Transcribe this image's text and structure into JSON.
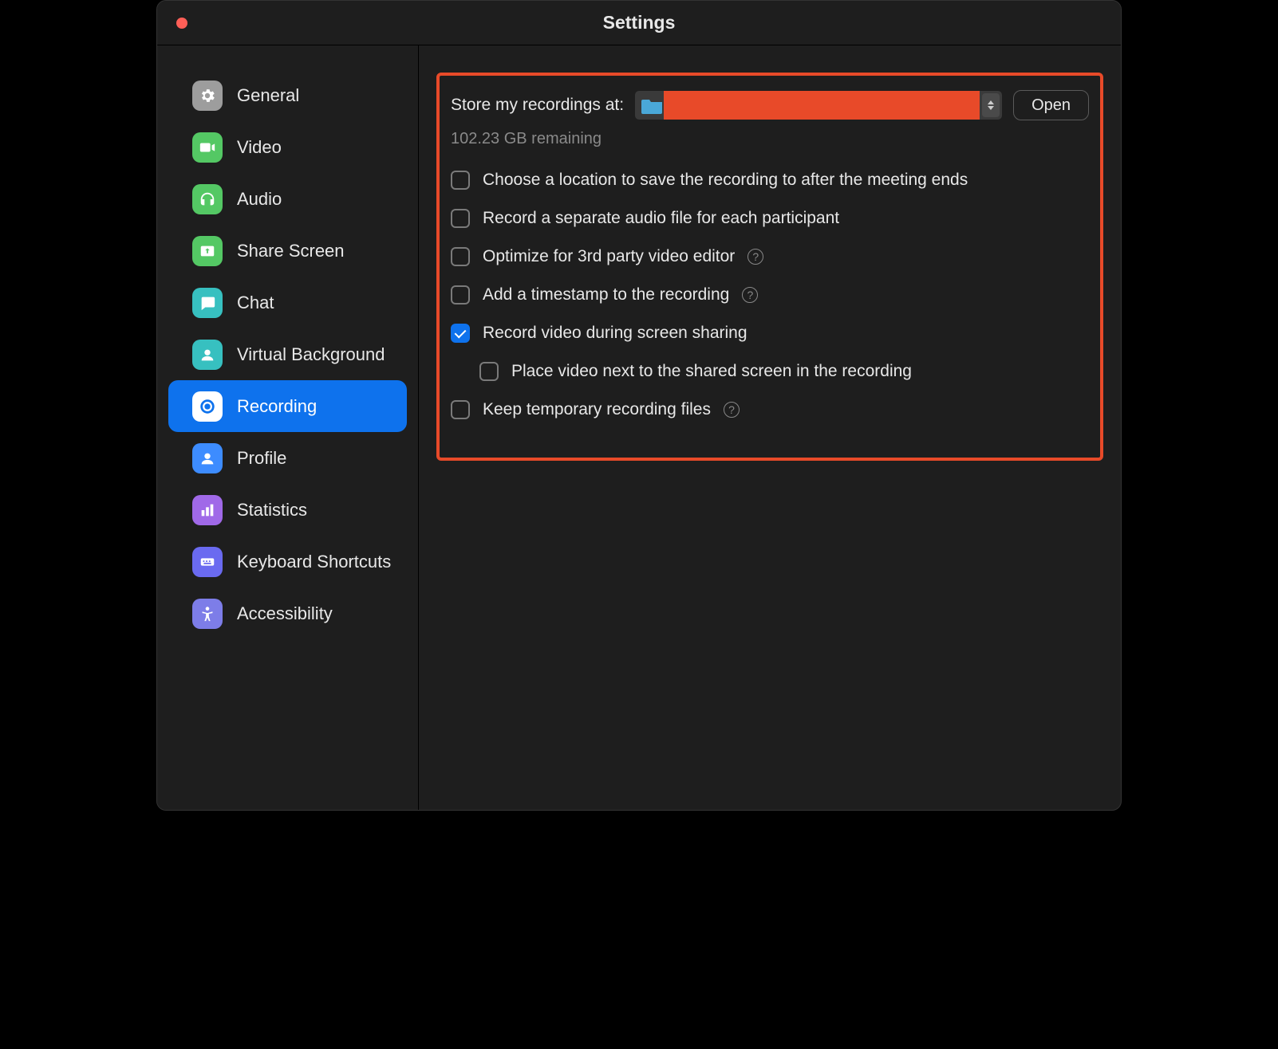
{
  "window": {
    "title": "Settings"
  },
  "sidebar": {
    "items": [
      {
        "label": "General"
      },
      {
        "label": "Video"
      },
      {
        "label": "Audio"
      },
      {
        "label": "Share Screen"
      },
      {
        "label": "Chat"
      },
      {
        "label": "Virtual Background"
      },
      {
        "label": "Recording"
      },
      {
        "label": "Profile"
      },
      {
        "label": "Statistics"
      },
      {
        "label": "Keyboard Shortcuts"
      },
      {
        "label": "Accessibility"
      }
    ],
    "selected_index": 6
  },
  "panel": {
    "store_label": "Store my recordings at:",
    "open_button": "Open",
    "remaining": "102.23 GB remaining",
    "options": [
      {
        "label": "Choose a location to save the recording to after the meeting ends",
        "checked": false,
        "help": false,
        "nested": false
      },
      {
        "label": "Record a separate audio file for each participant",
        "checked": false,
        "help": false,
        "nested": false
      },
      {
        "label": "Optimize for 3rd party video editor",
        "checked": false,
        "help": true,
        "nested": false
      },
      {
        "label": "Add a timestamp to the recording",
        "checked": false,
        "help": true,
        "nested": false
      },
      {
        "label": "Record video during screen sharing",
        "checked": true,
        "help": false,
        "nested": false
      },
      {
        "label": "Place video next to the shared screen in the recording",
        "checked": false,
        "help": false,
        "nested": true
      },
      {
        "label": "Keep temporary recording files",
        "checked": false,
        "help": true,
        "nested": false
      }
    ]
  }
}
